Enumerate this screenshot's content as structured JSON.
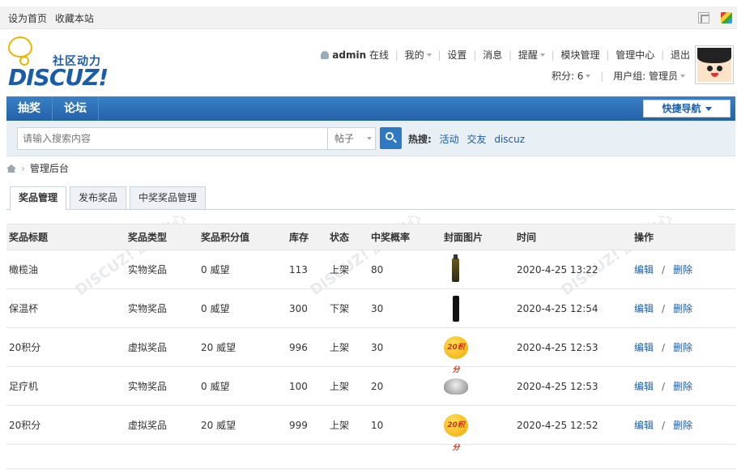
{
  "topbar": {
    "set_home": "设为首页",
    "bookmark": "收藏本站"
  },
  "logo": {
    "sub": "社区动力",
    "text": "DISCUZ!"
  },
  "usermenu": {
    "username": "admin",
    "online": "在线",
    "items": [
      "我的",
      "设置",
      "消息",
      "提醒",
      "模块管理",
      "管理中心",
      "退出"
    ]
  },
  "userinfo": {
    "points": "积分: 6",
    "group": "用户组: 管理员"
  },
  "nav": {
    "items": [
      "抽奖",
      "论坛"
    ],
    "quick": "快捷导航"
  },
  "search": {
    "placeholder": "请输入搜索内容",
    "type": "帖子",
    "hot_label": "热搜:",
    "hot_items": [
      "活动",
      "交友",
      "discuz"
    ]
  },
  "breadcrumb": {
    "current": "管理后台"
  },
  "tabs": [
    "奖品管理",
    "发布奖品",
    "中奖奖品管理"
  ],
  "table": {
    "headers": [
      "奖品标题",
      "奖品类型",
      "奖品积分值",
      "库存",
      "状态",
      "中奖概率",
      "封面图片",
      "时间",
      "操作"
    ],
    "rows": [
      {
        "title": "橄榄油",
        "type": "实物奖品",
        "points": "0 威望",
        "stock": "113",
        "status": "上架",
        "rate": "80",
        "image": "olive-oil-bottle",
        "time": "2020-4-25 13:22",
        "edit": "编辑",
        "delete": "删除"
      },
      {
        "title": "保温杯",
        "type": "实物奖品",
        "points": "0 威望",
        "stock": "300",
        "status": "下架",
        "rate": "30",
        "image": "thermos-cup",
        "time": "2020-4-25 12:54",
        "edit": "编辑",
        "delete": "删除"
      },
      {
        "title": "20积分",
        "type": "虚拟奖品",
        "points": "20 威望",
        "stock": "996",
        "status": "上架",
        "rate": "30",
        "image": "points-badge",
        "time": "2020-4-25 12:53",
        "edit": "编辑",
        "delete": "删除"
      },
      {
        "title": "足疗机",
        "type": "实物奖品",
        "points": "0 威望",
        "stock": "100",
        "status": "上架",
        "rate": "20",
        "image": "foot-bath-machine",
        "time": "2020-4-25 12:53",
        "edit": "编辑",
        "delete": "删除"
      },
      {
        "title": "20积分",
        "type": "虚拟奖品",
        "points": "20 威望",
        "stock": "999",
        "status": "上架",
        "rate": "10",
        "image": "points-badge",
        "time": "2020-4-25 12:52",
        "edit": "编辑",
        "delete": "删除"
      }
    ],
    "op_sep": "/"
  },
  "badge_text": "20积分"
}
